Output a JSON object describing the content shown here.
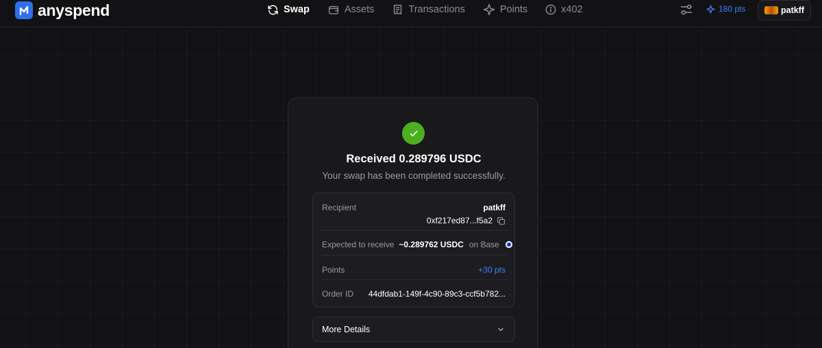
{
  "nav": {
    "brand": "anyspend",
    "items": [
      {
        "label": "Swap",
        "icon": "refresh-icon",
        "active": true
      },
      {
        "label": "Assets",
        "icon": "wallet-icon",
        "active": false
      },
      {
        "label": "Transactions",
        "icon": "receipt-icon",
        "active": false
      },
      {
        "label": "Points",
        "icon": "sparkle-icon",
        "active": false
      },
      {
        "label": "x402",
        "icon": "info-circle-icon",
        "active": false
      }
    ],
    "points": "180 pts",
    "username": "patkff"
  },
  "result": {
    "title": "Received 0.289796 USDC",
    "subtitle": "Your swap has been completed successfully.",
    "recipient_label": "Recipient",
    "recipient_name": "patkff",
    "recipient_address": "0xf217ed87...f5a2",
    "expected_label": "Expected to receive",
    "expected_amount": "~0.289762 USDC",
    "expected_chain": "on Base",
    "points_label": "Points",
    "points_value": "+30 pts",
    "order_label": "Order ID",
    "order_id": "44dfdab1-149f-4c90-89c3-ccf5b782...",
    "more_details_label": "More Details"
  },
  "colors": {
    "accent": "#3b82f6",
    "success": "#4caf20",
    "background": "#121214",
    "card": "#19191c"
  }
}
